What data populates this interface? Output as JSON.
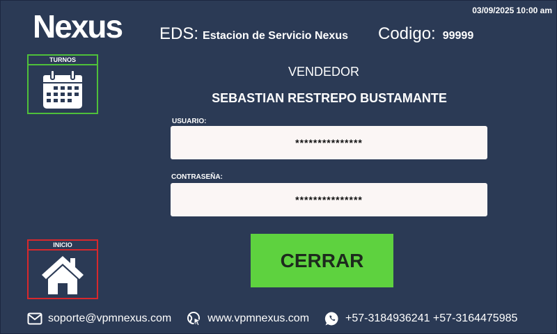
{
  "datetime": "03/09/2025 10:00 am",
  "logo": {
    "text_pre": "Ne",
    "text_x": "x",
    "text_post": "us",
    "icon": "nexus-logo"
  },
  "header": {
    "eds_label": "EDS:",
    "eds_value": "Estacion de Servicio Nexus",
    "codigo_label": "Codigo:",
    "codigo_value": "99999"
  },
  "side_buttons": {
    "turnos": {
      "label": "TURNOS",
      "icon": "calendar-icon",
      "color": "#4fc03a"
    },
    "inicio": {
      "label": "INICIO",
      "icon": "home-icon",
      "color": "#d8282c"
    }
  },
  "vendedor": {
    "label": "VENDEDOR",
    "name": "SEBASTIAN RESTREPO BUSTAMANTE"
  },
  "form": {
    "usuario_label": "USUARIO:",
    "usuario_value": "***************",
    "password_label": "CONTRASEÑA:",
    "password_value": "***************"
  },
  "actions": {
    "cerrar_label": "CERRAR",
    "cerrar_color": "#5ed23f"
  },
  "footer": {
    "email": "soporte@vpmnexus.com",
    "website": "www.vpmnexus.com",
    "phones": "+57-3184936241 +57-3164475985"
  },
  "colors": {
    "background": "#2b3a55",
    "field_bg": "#fbf6f5"
  }
}
